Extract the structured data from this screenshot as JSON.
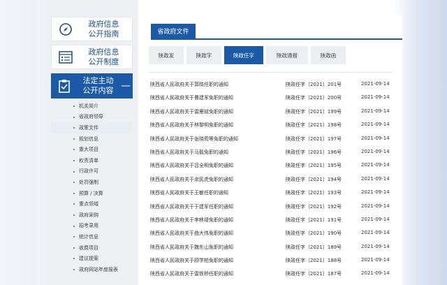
{
  "sidebar": {
    "cards": [
      {
        "label_line1": "政府信息",
        "label_line2": "公开指南",
        "icon": "compass-icon"
      },
      {
        "label_line1": "政府信息",
        "label_line2": "公开制度",
        "icon": "document-list-icon"
      }
    ],
    "active": {
      "label_line1": "法定主动",
      "label_line2": "公开内容",
      "icon": "clipboard-icon",
      "toggle": "—"
    },
    "items": [
      {
        "label": "机关简介"
      },
      {
        "label": "省政府领导"
      },
      {
        "label": "政策文件"
      },
      {
        "label": "规划信息"
      },
      {
        "label": "重大项目"
      },
      {
        "label": "权责清单"
      },
      {
        "label": "行政许可"
      },
      {
        "label": "处罚强制"
      },
      {
        "label": "预算 / 决算"
      },
      {
        "label": "重点领域"
      },
      {
        "label": "政府采购"
      },
      {
        "label": "招考录用"
      },
      {
        "label": "统计信息"
      },
      {
        "label": "收费项目"
      },
      {
        "label": "建议提案"
      },
      {
        "label": "政府网站年度报表"
      }
    ]
  },
  "main": {
    "tab_title": "省政府文件",
    "filters": [
      "陕政发",
      "陕政字",
      "陕政任字",
      "陕政通报",
      "陕政函"
    ],
    "active_filter_index": 2,
    "rows": [
      {
        "title": "陕西省人民政府关于郭晓任职的通知",
        "number": "陕政任字〔2021〕201号",
        "date": "2021-09-14"
      },
      {
        "title": "陕西省人民政府关于曹建军免职的通知",
        "number": "陕政任字〔2021〕200号",
        "date": "2021-09-14"
      },
      {
        "title": "陕西省人民政府关于雷雁斌免职的通知",
        "number": "陕政任字〔2021〕199号",
        "date": "2021-09-14"
      },
      {
        "title": "陕西省人民政府关于林黎明免职的通知",
        "number": "陕政任字〔2021〕198号",
        "date": "2021-09-14"
      },
      {
        "title": "陕西省人民政府关于张晓菀等免职的通知",
        "number": "陕政任字〔2021〕197号",
        "date": "2021-09-14"
      },
      {
        "title": "陕西省人民政府关于马毅免职的通知",
        "number": "陕政任字〔2021〕196号",
        "date": "2021-09-14"
      },
      {
        "title": "陕西省人民政府关于吕全明免职的通知",
        "number": "陕政任字〔2021〕195号",
        "date": "2021-09-14"
      },
      {
        "title": "陕西省人民政府关于余民虎免职的通知",
        "number": "陕政任字〔2021〕194号",
        "date": "2021-09-14"
      },
      {
        "title": "陕西省人民政府关于王敏任职的通知",
        "number": "陕政任字〔2021〕193号",
        "date": "2021-09-14"
      },
      {
        "title": "陕西省人民政府关于于建军任职的通知",
        "number": "陕政任字〔2021〕192号",
        "date": "2021-09-14"
      },
      {
        "title": "陕西省人民政府关于李移禄免职的通知",
        "number": "陕政任字〔2021〕191号",
        "date": "2021-09-14"
      },
      {
        "title": "陕西省人民政府关于曲大伟免职的通知",
        "number": "陕政任字〔2021〕190号",
        "date": "2021-09-14"
      },
      {
        "title": "陕西省人民政府关于魏东山免职的通知",
        "number": "陕政任字〔2021〕189号",
        "date": "2021-09-14"
      },
      {
        "title": "陕西省人民政府关于顾学柏免职的通知",
        "number": "陕政任字〔2021〕188号",
        "date": "2021-09-14"
      },
      {
        "title": "陕西省人民政府关于雷铁桥任职的通知",
        "number": "陕政任字〔2021〕187号",
        "date": "2021-09-14"
      }
    ]
  },
  "colors": {
    "accent": "#1a5aa6",
    "panel_bg": "#eef0f3"
  }
}
